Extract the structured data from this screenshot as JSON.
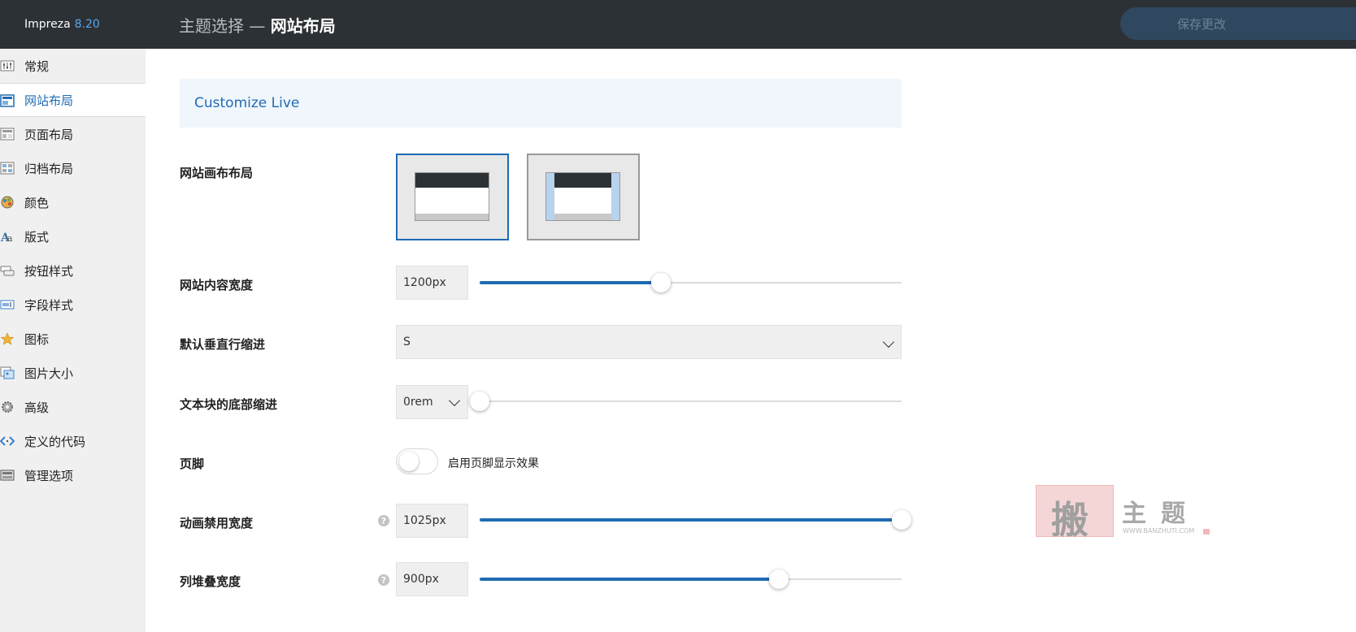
{
  "app": {
    "name": "Impreza",
    "version": "8.20"
  },
  "header": {
    "prefix": "主题选择 — ",
    "title": "网站布局",
    "save_label": "保存更改"
  },
  "sidebar": {
    "items": [
      {
        "label": "常规",
        "icon": "sliders-icon"
      },
      {
        "label": "网站布局",
        "icon": "layout-icon",
        "active": true
      },
      {
        "label": "页面布局",
        "icon": "page-layout-icon"
      },
      {
        "label": "归档布局",
        "icon": "archive-layout-icon"
      },
      {
        "label": "颜色",
        "icon": "color-palette-icon"
      },
      {
        "label": "版式",
        "icon": "typography-icon"
      },
      {
        "label": "按钮样式",
        "icon": "button-style-icon"
      },
      {
        "label": "字段样式",
        "icon": "field-style-icon"
      },
      {
        "label": "图标",
        "icon": "star-icon"
      },
      {
        "label": "图片大小",
        "icon": "image-size-icon"
      },
      {
        "label": "高级",
        "icon": "gear-icon"
      },
      {
        "label": "定义的代码",
        "icon": "code-icon"
      },
      {
        "label": "管理选项",
        "icon": "manage-icon"
      }
    ]
  },
  "banner": {
    "text": "Customize Live"
  },
  "settings": {
    "canvas_layout": {
      "label": "网站画布布局",
      "selected": "wide"
    },
    "content_width": {
      "label": "网站内容宽度",
      "value": "1200px",
      "slider_fraction": 0.43
    },
    "row_indent": {
      "label": "默认垂直行缩进",
      "value": "S"
    },
    "text_bottom_indent": {
      "label": "文本块的底部缩进",
      "value": "0rem",
      "slider_fraction": 0.0
    },
    "footer": {
      "label": "页脚",
      "toggle_text": "启用页脚显示效果",
      "enabled": false
    },
    "animation_disable_width": {
      "label": "动画禁用宽度",
      "value": "1025px",
      "slider_fraction": 1.0
    },
    "column_stack_width": {
      "label": "列堆叠宽度",
      "value": "900px",
      "slider_fraction": 0.71
    }
  },
  "watermark": {
    "char": "搬",
    "text": "主题",
    "url": "WWW.BANZHUTI.COM"
  },
  "colors": {
    "accent": "#1f6bb3",
    "topbar": "#2c3135",
    "sidebar_bg": "#f0f0f0",
    "banner_bg": "#f0f6fc"
  }
}
